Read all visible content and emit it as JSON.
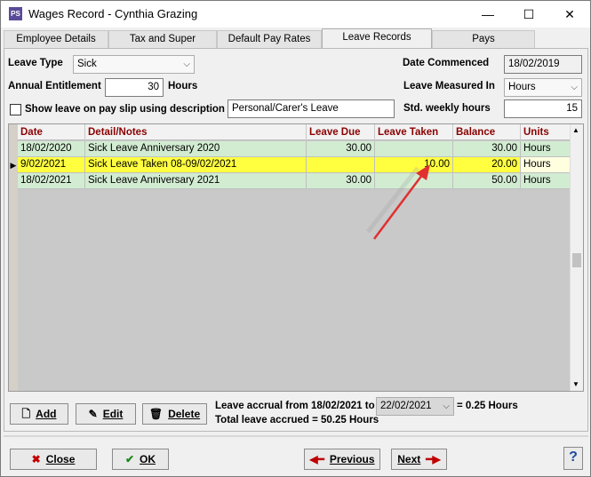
{
  "window": {
    "title": "Wages Record - Cynthia Grazing",
    "app_icon": "PS",
    "minimize": "—",
    "maximize": "☐",
    "close": "✕"
  },
  "tabs": [
    {
      "label": "Employee Details"
    },
    {
      "label": "Tax and Super"
    },
    {
      "label": "Default Pay Rates"
    },
    {
      "label": "Leave Records"
    },
    {
      "label": "Pays"
    }
  ],
  "form": {
    "leave_type_label": "Leave Type",
    "leave_type_value": "Sick",
    "date_commenced_label": "Date Commenced",
    "date_commenced_value": "18/02/2019",
    "annual_entitlement_label": "Annual Entitlement",
    "annual_entitlement_value": "30",
    "annual_entitlement_unit": "Hours",
    "leave_measured_label": "Leave Measured In",
    "leave_measured_value": "Hours",
    "show_leave_label": "Show leave on pay slip using description",
    "show_leave_value": "Personal/Carer's Leave",
    "std_weekly_label": "Std. weekly hours",
    "std_weekly_value": "15"
  },
  "grid": {
    "columns": [
      "Date",
      "Detail/Notes",
      "Leave Due",
      "Leave Taken",
      "Balance",
      "Units"
    ],
    "rows": [
      {
        "date": "18/02/2020",
        "detail": "Sick Leave Anniversary 2020",
        "due": "30.00",
        "taken": "",
        "balance": "30.00",
        "units": "Hours"
      },
      {
        "date": "9/02/2021",
        "detail": "Sick Leave Taken 08-09/02/2021",
        "due": "",
        "taken": "10.00",
        "balance": "20.00",
        "units": "Hours"
      },
      {
        "date": "18/02/2021",
        "detail": "Sick Leave Anniversary 2021",
        "due": "30.00",
        "taken": "",
        "balance": "50.00",
        "units": "Hours"
      }
    ]
  },
  "actions": {
    "add": "Add",
    "edit": "Edit",
    "delete": "Delete",
    "accrual_label": "Leave accrual from 18/02/2021 to",
    "accrual_date": "22/02/2021",
    "accrual_result": "= 0.25 Hours",
    "total_accrued": "Total leave accrued = 50.25 Hours"
  },
  "footer": {
    "close": "Close",
    "ok": "OK",
    "previous": "Previous",
    "next": "Next",
    "help": "?"
  },
  "colors": {
    "green_row": "#d2ecd2",
    "yellow_row": "#ffff40",
    "header_text": "#8b0000",
    "arrow": "#e03030"
  }
}
